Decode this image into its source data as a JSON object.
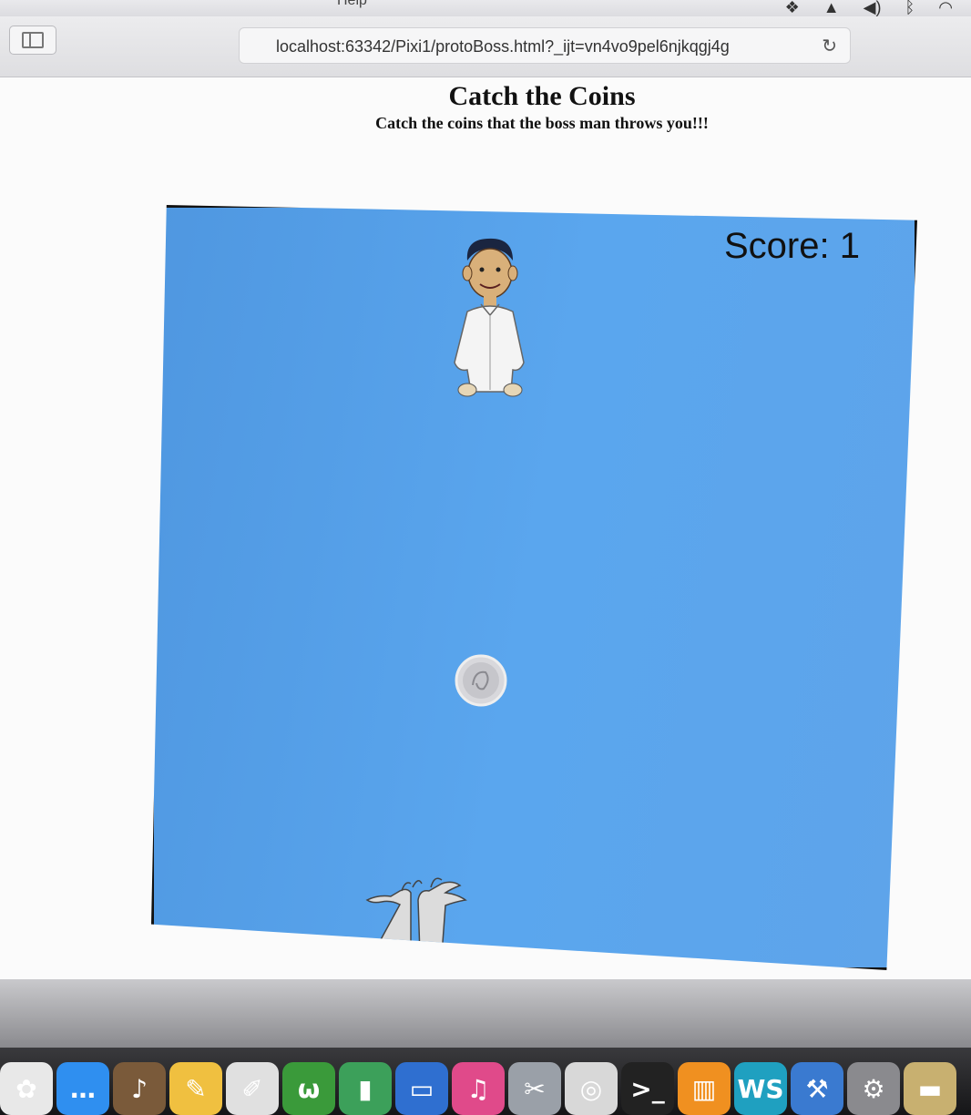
{
  "browser": {
    "url": "localhost:63342/Pixi1/protoBoss.html?_ijt=vn4vo9pel6njkqgj4g",
    "menu_partial": "Help"
  },
  "page": {
    "title": "Catch the Coins",
    "subtitle": "Catch the coins that the boss man throws you!!!"
  },
  "game": {
    "score_text": "Score: 1",
    "canvas_color": "#5aa6ee"
  },
  "dock": {
    "apps": [
      {
        "icon": "photos-icon",
        "glyph": "✿",
        "color": "#e8e8e8"
      },
      {
        "icon": "messages-icon",
        "glyph": "…",
        "color": "#2f8ff0"
      },
      {
        "icon": "garageband-icon",
        "glyph": "♪",
        "color": "#7a5a3a"
      },
      {
        "icon": "notes-icon",
        "glyph": "✎",
        "color": "#f0c040"
      },
      {
        "icon": "textedit-icon",
        "glyph": "✐",
        "color": "#e0e0e0"
      },
      {
        "icon": "webex-icon",
        "glyph": "ω",
        "color": "#3a9a3a"
      },
      {
        "icon": "numbers-icon",
        "glyph": "▮",
        "color": "#3ca05a"
      },
      {
        "icon": "keynote-icon",
        "glyph": "▭",
        "color": "#2f6fd0"
      },
      {
        "icon": "itunes-icon",
        "glyph": "♫",
        "color": "#e04a8a"
      },
      {
        "icon": "preview-icon",
        "glyph": "✂",
        "color": "#9aa0a8"
      },
      {
        "icon": "safari-icon",
        "glyph": "◎",
        "color": "#d8d8d8"
      },
      {
        "icon": "terminal-icon",
        "glyph": ">_",
        "color": "#222222"
      },
      {
        "icon": "ibooks-icon",
        "glyph": "▥",
        "color": "#f09020"
      },
      {
        "icon": "webstorm-icon",
        "glyph": "WS",
        "color": "#1fa0c0"
      },
      {
        "icon": "xcode-icon",
        "glyph": "⚒",
        "color": "#3a7ad0"
      },
      {
        "icon": "system-preferences-icon",
        "glyph": "⚙",
        "color": "#8a8a8e"
      },
      {
        "icon": "folder-icon",
        "glyph": "▬",
        "color": "#c8b070"
      }
    ]
  }
}
